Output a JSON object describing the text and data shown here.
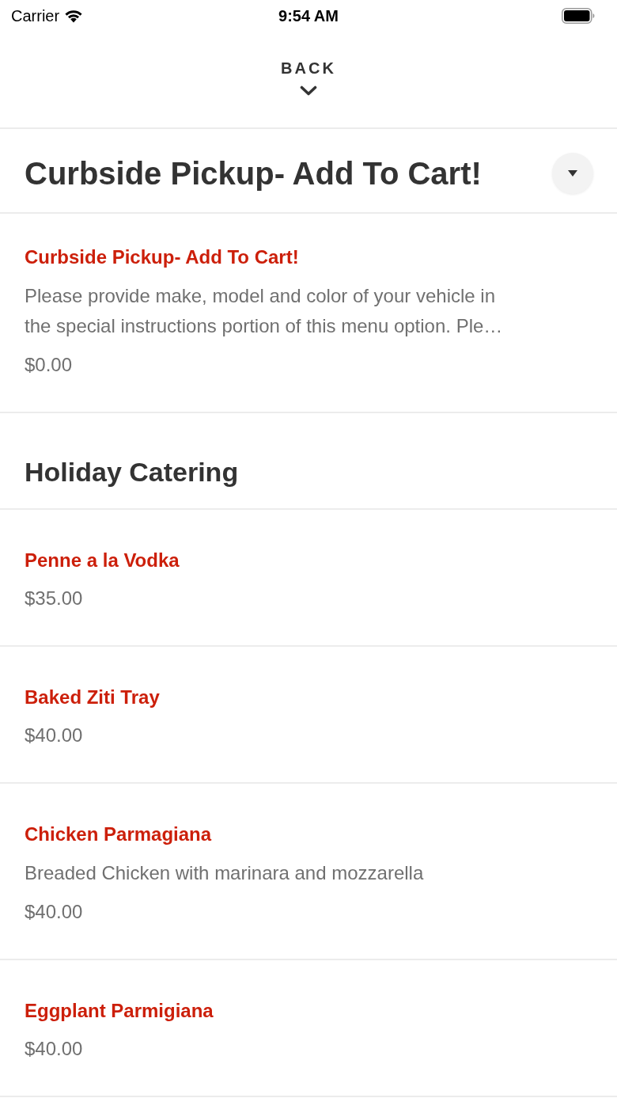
{
  "status_bar": {
    "carrier": "Carrier",
    "time": "9:54 AM"
  },
  "back_button": {
    "label": "BACK"
  },
  "category_picker": {
    "label": "Curbside Pickup- Add To Cart!"
  },
  "sections": [
    {
      "items": [
        {
          "name": "Curbside Pickup- Add To Cart!",
          "description": "Please provide make, model and color of your vehicle in the special instructions portion of this menu option. Ple…",
          "price": "$0.00"
        }
      ]
    },
    {
      "title": "Holiday Catering",
      "items": [
        {
          "name": "Penne a la Vodka",
          "price": "$35.00"
        },
        {
          "name": "Baked Ziti Tray",
          "price": "$40.00"
        },
        {
          "name": "Chicken Parmagiana",
          "description": "Breaded Chicken with marinara and mozzarella",
          "price": "$40.00"
        },
        {
          "name": "Eggplant Parmigiana",
          "price": "$40.00"
        }
      ]
    }
  ]
}
